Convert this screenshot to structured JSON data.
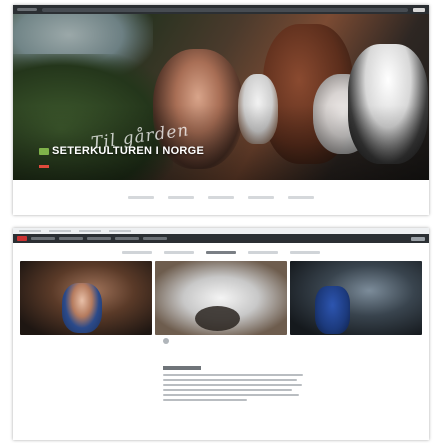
{
  "hero": {
    "script_text": "Til gården",
    "title": "SETERKULTUREN I NORGE"
  },
  "colors": {
    "nav_dark": "#2b2f33",
    "accent_red": "#e04a3b",
    "logo_green": "#7fb24a"
  },
  "icons": {
    "logo": "logo-mark"
  }
}
